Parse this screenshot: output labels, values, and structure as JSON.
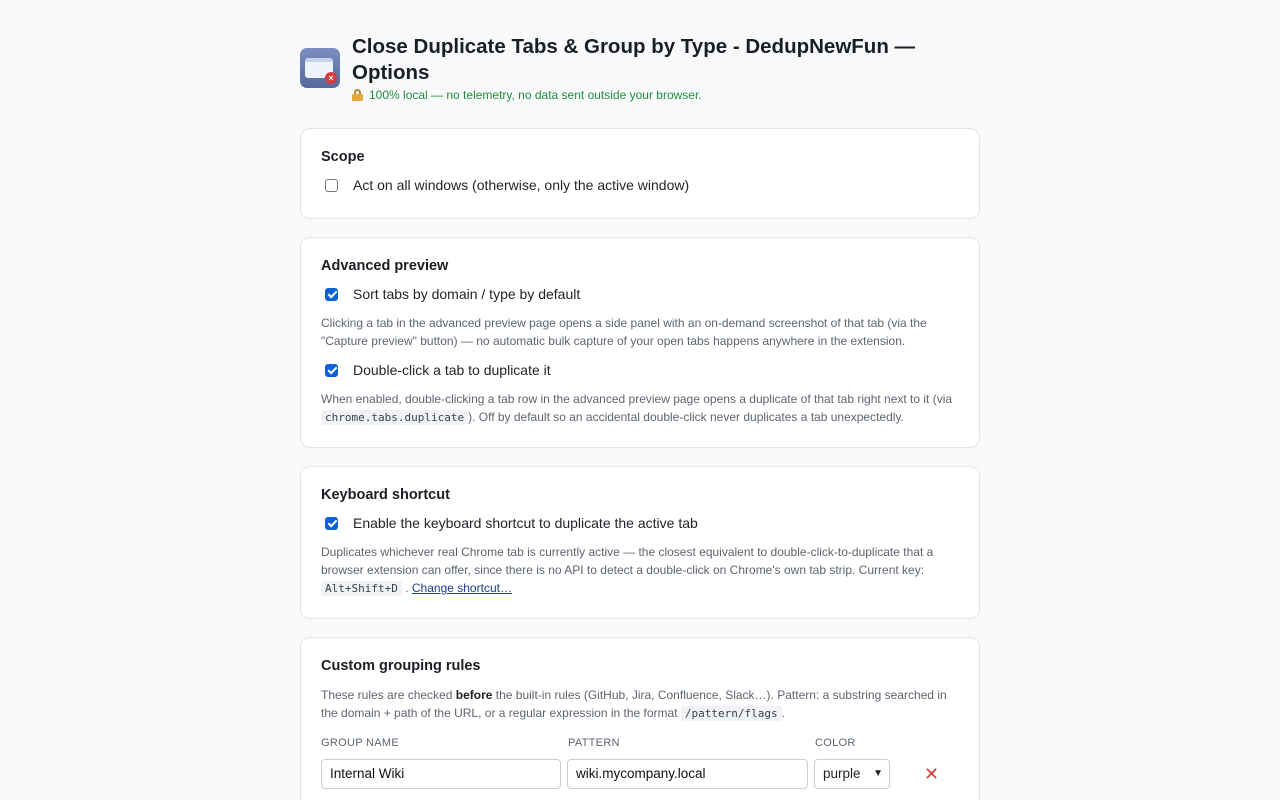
{
  "header": {
    "title": "Close Duplicate Tabs & Group by Type - DedupNewFun — Options",
    "subtitle": "100% local — no telemetry, no data sent outside your browser."
  },
  "scope": {
    "heading": "Scope",
    "all_windows_label": "Act on all windows (otherwise, only the active window)",
    "all_windows_checked": false
  },
  "advanced_preview": {
    "heading": "Advanced preview",
    "sort_label": "Sort tabs by domain / type by default",
    "sort_checked": true,
    "sort_help": "Clicking a tab in the advanced preview page opens a side panel with an on-demand screenshot of that tab (via the \"Capture preview\" button) — no automatic bulk capture of your open tabs happens anywhere in the extension.",
    "dblclick_label": "Double-click a tab to duplicate it",
    "dblclick_checked": true,
    "dblclick_help_before": "When enabled, double-clicking a tab row in the advanced preview page opens a duplicate of that tab right next to it (via",
    "dblclick_help_code": "chrome.tabs.duplicate",
    "dblclick_help_after": "). Off by default so an accidental double-click never duplicates a tab unexpectedly."
  },
  "keyboard": {
    "heading": "Keyboard shortcut",
    "enable_label": "Enable the keyboard shortcut to duplicate the active tab",
    "enable_checked": true,
    "help_text": "Duplicates whichever real Chrome tab is currently active — the closest equivalent to double-click-to-duplicate that a browser extension can offer, since there is no API to detect a double-click on Chrome's own tab strip. Current key:",
    "current_key": "Alt+Shift+D",
    "separator": ".",
    "change_link": "Change shortcut…"
  },
  "custom_rules": {
    "heading": "Custom grouping rules",
    "help_before": "These rules are checked",
    "help_bold": "before",
    "help_middle": "the built-in rules (GitHub, Jira, Confluence, Slack…). Pattern: a substring searched in the domain + path of the URL, or a regular expression in the format",
    "help_code": "/pattern/flags",
    "help_after": ".",
    "col_group_name": "GROUP NAME",
    "col_pattern": "PATTERN",
    "col_color": "COLOR",
    "rules": [
      {
        "group_name": "Internal Wiki",
        "pattern": "wiki.mycompany.local",
        "color": "purple"
      }
    ]
  },
  "colors": {
    "accent": "#0b63d1",
    "success_text": "#1f8f3a",
    "danger": "#d63a3a"
  }
}
